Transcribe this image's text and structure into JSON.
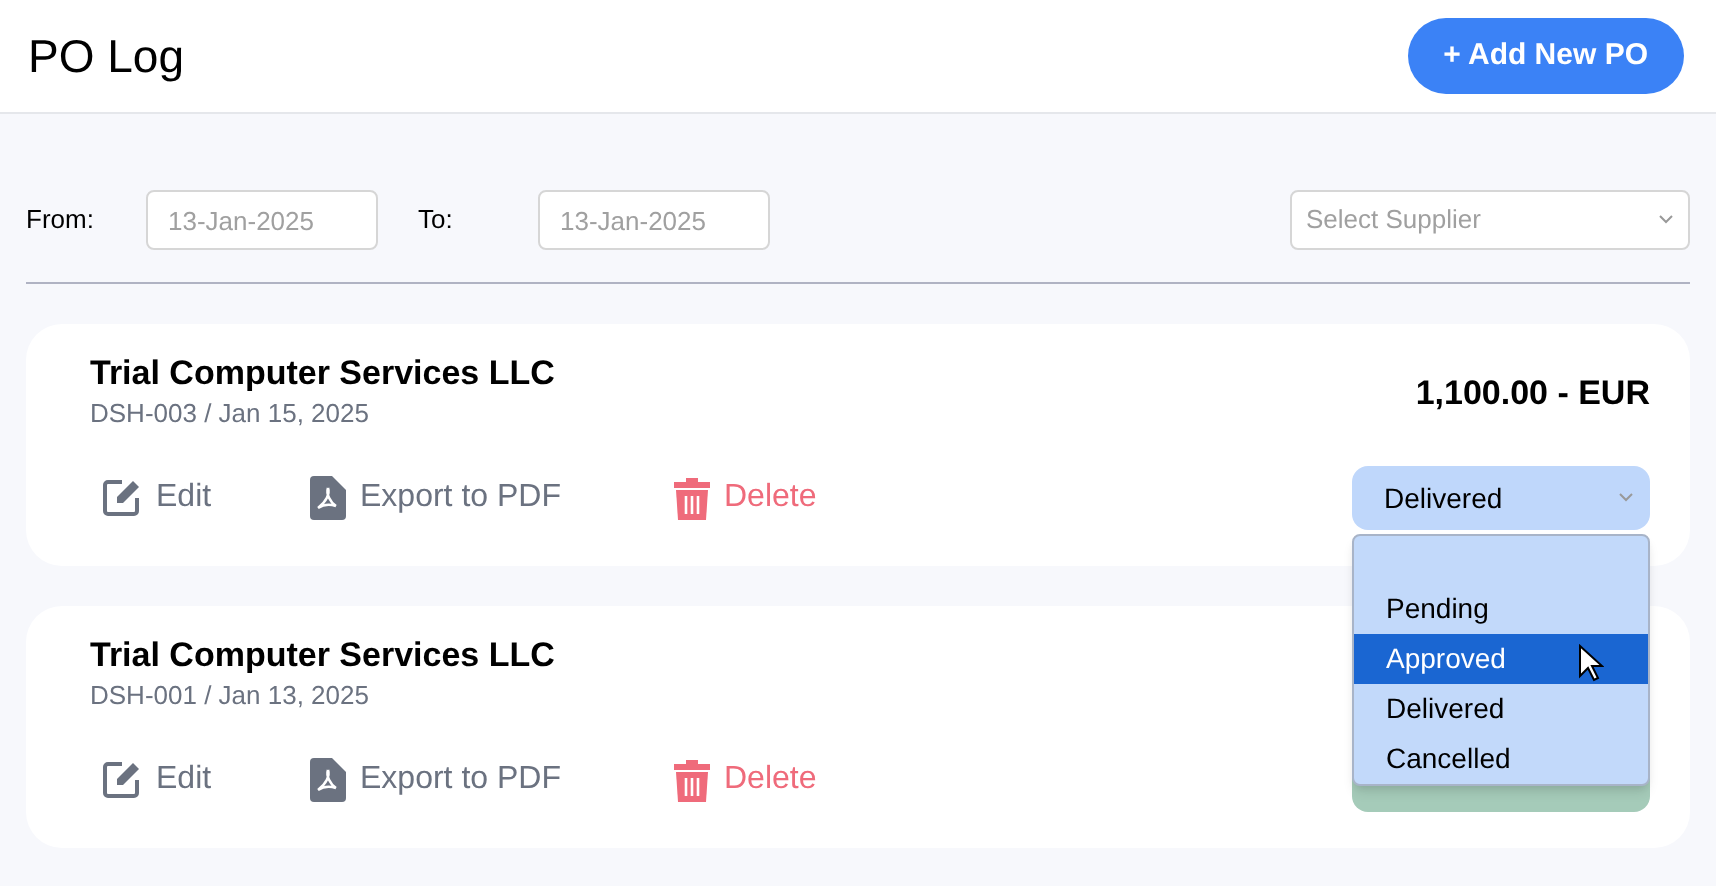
{
  "header": {
    "title": "PO Log",
    "add_button": "+ Add New PO"
  },
  "filters": {
    "from_label": "From:",
    "from_placeholder": "13-Jan-2025",
    "to_label": "To:",
    "to_placeholder": "13-Jan-2025",
    "supplier_placeholder": "Select Supplier"
  },
  "orders": [
    {
      "supplier": "Trial Computer Services LLC",
      "reference": "DSH-003 / Jan 15, 2025",
      "amount": "1,100.00 - EUR",
      "actions": [
        "Edit",
        "Export to PDF",
        "Delete"
      ],
      "status": {
        "label": "Delivered",
        "color": "#bfd7fb"
      }
    },
    {
      "supplier": "Trial Computer Services LLC",
      "reference": "DSH-001 / Jan 13, 2025",
      "actions": [
        "Edit",
        "Export to PDF",
        "Delete"
      ],
      "status": {
        "color": "#a5cbb9"
      }
    }
  ],
  "status_dropdown": {
    "open": true,
    "options": [
      {
        "label": "Pending",
        "selected": false
      },
      {
        "label": "Approved",
        "selected": true
      },
      {
        "label": "Delivered",
        "selected": false
      },
      {
        "label": "Cancelled",
        "selected": false
      }
    ]
  }
}
